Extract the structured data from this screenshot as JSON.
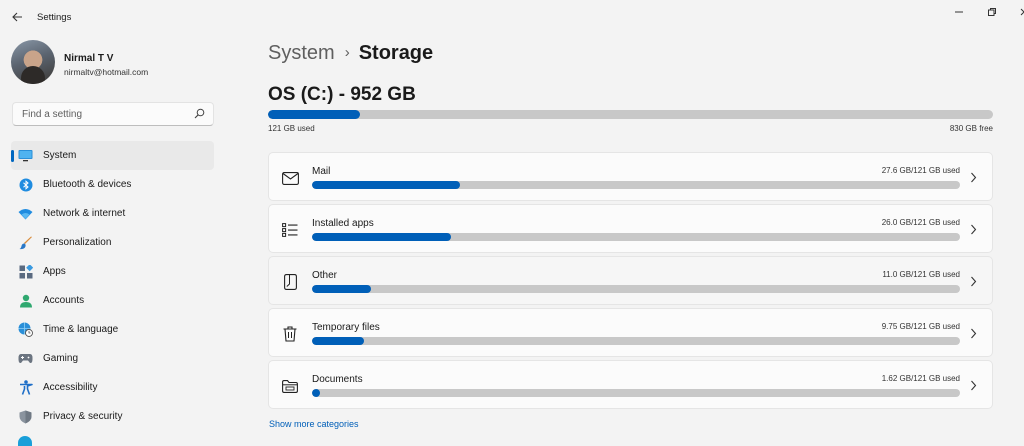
{
  "window": {
    "title": "Settings",
    "back_icon": "arrow-left-icon",
    "minimize_icon": "minimize-icon",
    "restore_icon": "restore-icon",
    "close_icon": "close-icon"
  },
  "profile": {
    "name": "Nirmal T V",
    "email": "nirmaltv@hotmail.com"
  },
  "search": {
    "placeholder": "Find a setting",
    "value": ""
  },
  "sidebar": {
    "items": [
      {
        "label": "System",
        "icon": "monitor-icon",
        "active": true
      },
      {
        "label": "Bluetooth & devices",
        "icon": "bluetooth-icon",
        "active": false
      },
      {
        "label": "Network & internet",
        "icon": "wifi-icon",
        "active": false
      },
      {
        "label": "Personalization",
        "icon": "brush-icon",
        "active": false
      },
      {
        "label": "Apps",
        "icon": "apps-icon",
        "active": false
      },
      {
        "label": "Accounts",
        "icon": "person-icon",
        "active": false
      },
      {
        "label": "Time & language",
        "icon": "globe-clock-icon",
        "active": false
      },
      {
        "label": "Gaming",
        "icon": "gamepad-icon",
        "active": false
      },
      {
        "label": "Accessibility",
        "icon": "accessibility-icon",
        "active": false
      },
      {
        "label": "Privacy & security",
        "icon": "shield-icon",
        "active": false
      }
    ]
  },
  "breadcrumb": {
    "parent": "System",
    "separator": "›",
    "current": "Storage"
  },
  "drive": {
    "title": "OS (C:) - 952 GB",
    "used_label": "121 GB used",
    "free_label": "830 GB free",
    "used_fraction": 0.127
  },
  "categories": [
    {
      "label": "Mail",
      "usage": "27.6 GB/121 GB used",
      "fraction": 0.228,
      "icon": "mail-icon"
    },
    {
      "label": "Installed apps",
      "usage": "26.0 GB/121 GB used",
      "fraction": 0.215,
      "icon": "list-icon"
    },
    {
      "label": "Other",
      "usage": "11.0 GB/121 GB used",
      "fraction": 0.091,
      "icon": "document-icon"
    },
    {
      "label": "Temporary files",
      "usage": "9.75 GB/121 GB used",
      "fraction": 0.081,
      "icon": "trash-icon"
    },
    {
      "label": "Documents",
      "usage": "1.62 GB/121 GB used",
      "fraction": 0.013,
      "icon": "folder-icon"
    }
  ],
  "show_more": "Show more categories",
  "colors": {
    "accent": "#005fb8",
    "bar_track": "#c8c8c8",
    "background": "#f3f3f3"
  }
}
